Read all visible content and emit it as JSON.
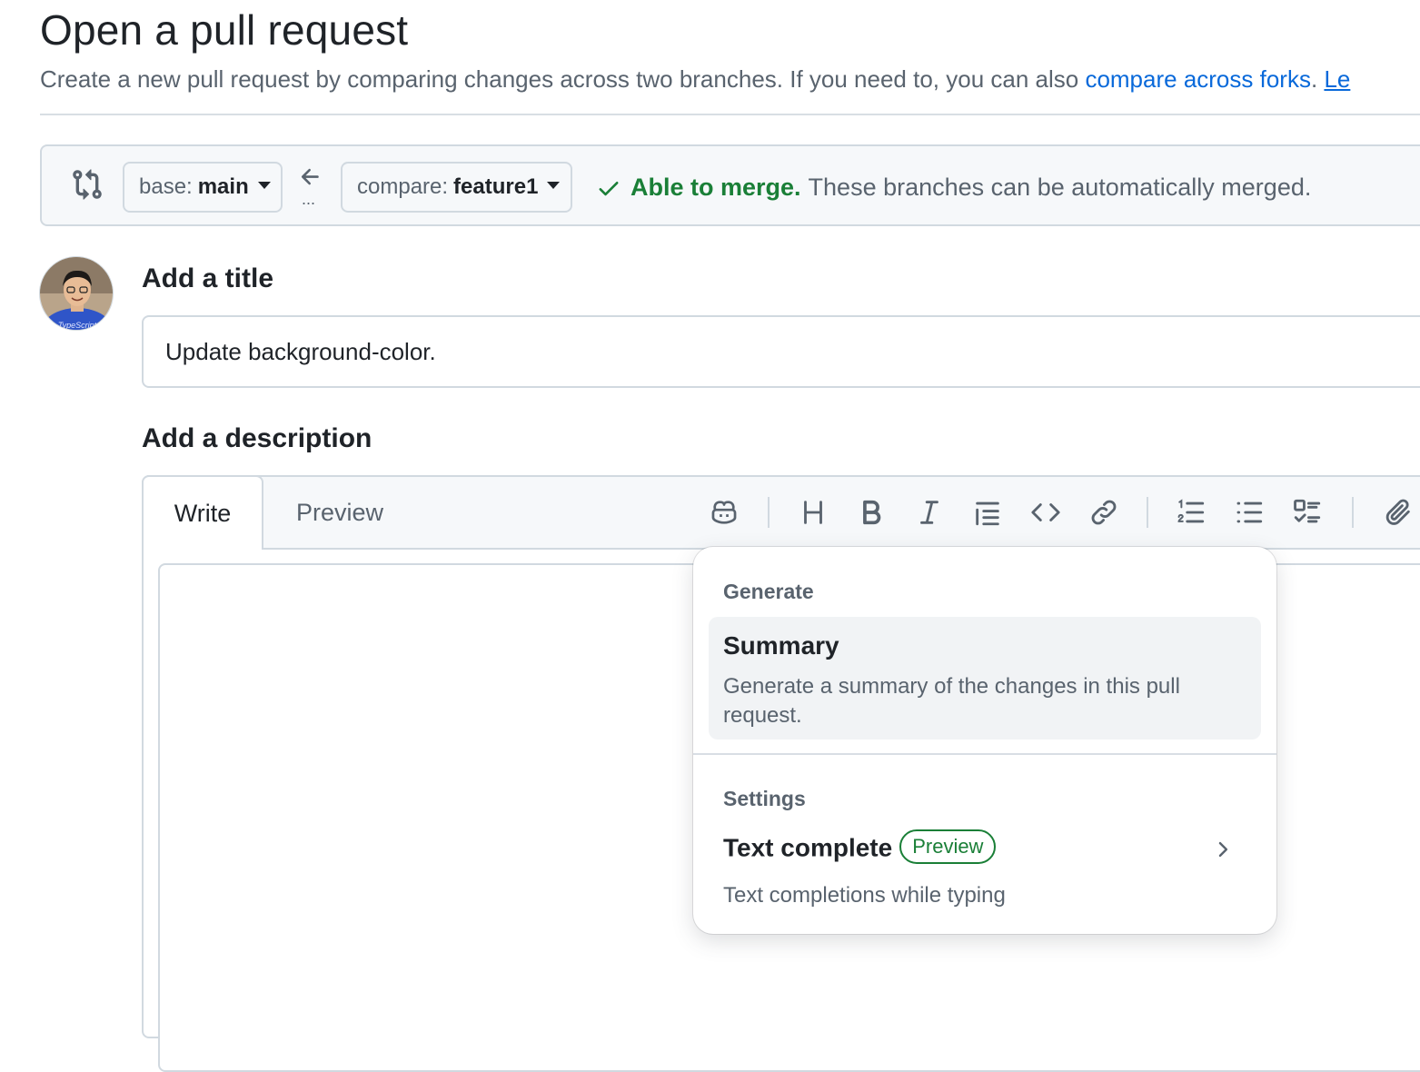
{
  "header": {
    "title": "Open a pull request",
    "subtitle_text": "Create a new pull request by comparing changes across two branches. If you need to, you can also ",
    "compare_forks_link": "compare across forks",
    "period": ".",
    "learn_link": "Le"
  },
  "compare_bar": {
    "base_label": "base:",
    "base_value": "main",
    "compare_label": "compare:",
    "compare_value": "feature1",
    "arrow_dots": "...",
    "merge_ok": "Able to merge.",
    "merge_text": "These branches can be automatically merged."
  },
  "avatar_text": "TypeScript",
  "form": {
    "title_label": "Add a title",
    "title_value": "Update background-color.",
    "description_label": "Add a description"
  },
  "editor": {
    "tabs": [
      {
        "label": "Write",
        "active": true
      },
      {
        "label": "Preview",
        "active": false
      }
    ],
    "toolbar_icons": [
      "copilot-icon",
      "heading-icon",
      "bold-icon",
      "italic-icon",
      "quote-icon",
      "code-icon",
      "link-icon",
      "numbered-list-icon",
      "unordered-list-icon",
      "task-list-icon",
      "attach-icon"
    ]
  },
  "menu": {
    "generate_heading": "Generate",
    "summary_title": "Summary",
    "summary_desc": "Generate a summary of the changes in this pull request.",
    "settings_heading": "Settings",
    "textcomplete_title": "Text complete",
    "textcomplete_badge": "Preview",
    "textcomplete_desc": "Text completions while typing"
  },
  "colors": {
    "link": "#0969da",
    "success": "#1a7f37",
    "border": "#d1d9e0",
    "muted": "#59636e",
    "text": "#1f2328"
  }
}
